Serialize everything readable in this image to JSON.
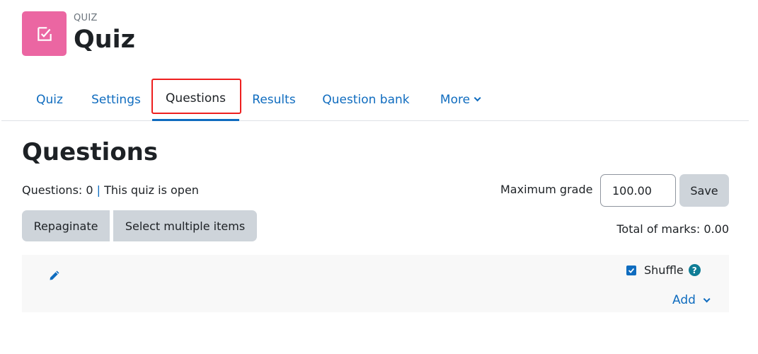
{
  "header": {
    "module_label": "QUIZ",
    "title": "Quiz",
    "icon": "checkbox-square-icon",
    "icon_color": "#eb66a2"
  },
  "tabs": [
    {
      "label": "Quiz",
      "active": false
    },
    {
      "label": "Settings",
      "active": false
    },
    {
      "label": "Questions",
      "active": true
    },
    {
      "label": "Results",
      "active": false
    },
    {
      "label": "Question bank",
      "active": false
    },
    {
      "label": "More",
      "active": false,
      "icon": "chevron-down-icon"
    }
  ],
  "main": {
    "title": "Questions",
    "status_count": "Questions: 0",
    "status_separator": "|",
    "status_state": "This quiz is open",
    "buttons": {
      "repaginate": "Repaginate",
      "select_multiple": "Select multiple items",
      "save": "Save"
    },
    "max_grade": {
      "label": "Maximum grade",
      "value": "100.00"
    },
    "total_marks": "Total of marks: 0.00",
    "section": {
      "edit_icon": "pencil-icon",
      "shuffle_label": "Shuffle",
      "shuffle_checked": true,
      "help_icon": "question-circle-icon",
      "add_label": "Add"
    }
  },
  "colors": {
    "link": "#0f6cbf",
    "button_bg": "#ced4da",
    "highlight": "#ee1f1f",
    "help": "#0f7d96"
  }
}
